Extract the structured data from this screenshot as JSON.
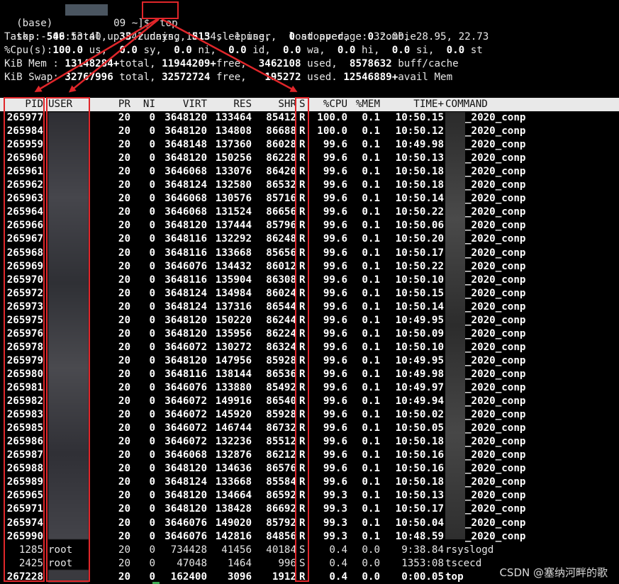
{
  "prompt": {
    "prefix": "(base) ",
    "host_suffix": "09 ~]$ ",
    "command": "top"
  },
  "summary": {
    "line1": "top - 09:53:40 up 542 days, 18:54,  1 user,  load average: 32.00, 28.95, 22.73",
    "tasks_label": "Tasks: ",
    "tasks_total": "546",
    "tasks_total_lbl": " total,  ",
    "tasks_running": "33",
    "tasks_running_lbl": " running, ",
    "tasks_sleeping": "513",
    "tasks_sleeping_lbl": " sleeping,   ",
    "tasks_stopped": "0",
    "tasks_stopped_lbl": " stopped,   ",
    "tasks_zombie": "0",
    "tasks_zombie_lbl": " zombie",
    "cpu_label": "%Cpu(s):",
    "cpu_us": "100.0",
    "cpu_us_lbl": " us,  ",
    "cpu_sy": "0.0",
    "cpu_sy_lbl": " sy,  ",
    "cpu_ni": "0.0",
    "cpu_ni_lbl": " ni,  ",
    "cpu_id": "0.0",
    "cpu_id_lbl": " id,  ",
    "cpu_wa": "0.0",
    "cpu_wa_lbl": " wa,  ",
    "cpu_hi": "0.0",
    "cpu_hi_lbl": " hi,  ",
    "cpu_si": "0.0",
    "cpu_si_lbl": " si,  ",
    "cpu_st": "0.0",
    "cpu_st_lbl": " st",
    "mem_label": "KiB Mem : ",
    "mem_total": "13148284+",
    "mem_total_lbl": "total, ",
    "mem_free": "11944209+",
    "mem_free_lbl": "free,  ",
    "mem_used": "3462108",
    "mem_used_lbl": " used,  ",
    "mem_cache": "8578632",
    "mem_cache_lbl": " buff/cache",
    "swap_label": "KiB Swap: ",
    "swap_total": "32767996",
    "swap_total_lbl": " total, ",
    "swap_free": "32572724",
    "swap_free_lbl": " free,   ",
    "swap_used": "195272",
    "swap_used_lbl": " used. ",
    "swap_avail": "12546889+",
    "swap_avail_lbl": "avail Mem"
  },
  "columns": {
    "pid": "PID",
    "user": "USER",
    "pr": "PR",
    "ni": "NI",
    "virt": "VIRT",
    "res": "RES",
    "shr": "SHR",
    "s": "S",
    "cpu": "%CPU",
    "mem": "%MEM",
    "time": "TIME+",
    "command": "COMMAND"
  },
  "processes": [
    {
      "pid": "265977",
      "user": "",
      "pr": "20",
      "ni": "0",
      "virt": "3648120",
      "res": "133464",
      "shr": "85412",
      "s": "R",
      "cpu": "100.0",
      "mem": "0.1",
      "time": "10:50.15",
      "command": "_2020_conp",
      "bold": true
    },
    {
      "pid": "265984",
      "user": "",
      "pr": "20",
      "ni": "0",
      "virt": "3648120",
      "res": "134808",
      "shr": "86688",
      "s": "R",
      "cpu": "100.0",
      "mem": "0.1",
      "time": "10:50.12",
      "command": "_2020_conp",
      "bold": true
    },
    {
      "pid": "265959",
      "user": "",
      "pr": "20",
      "ni": "0",
      "virt": "3648148",
      "res": "137360",
      "shr": "86028",
      "s": "R",
      "cpu": "99.6",
      "mem": "0.1",
      "time": "10:49.98",
      "command": "_2020_conp",
      "bold": true
    },
    {
      "pid": "265960",
      "user": "",
      "pr": "20",
      "ni": "0",
      "virt": "3648120",
      "res": "150256",
      "shr": "86228",
      "s": "R",
      "cpu": "99.6",
      "mem": "0.1",
      "time": "10:50.13",
      "command": "_2020_conp",
      "bold": true
    },
    {
      "pid": "265961",
      "user": "",
      "pr": "20",
      "ni": "0",
      "virt": "3646068",
      "res": "133076",
      "shr": "86420",
      "s": "R",
      "cpu": "99.6",
      "mem": "0.1",
      "time": "10:50.18",
      "command": "_2020_conp",
      "bold": true
    },
    {
      "pid": "265962",
      "user": "",
      "pr": "20",
      "ni": "0",
      "virt": "3648124",
      "res": "132580",
      "shr": "86532",
      "s": "R",
      "cpu": "99.6",
      "mem": "0.1",
      "time": "10:50.18",
      "command": "_2020_conp",
      "bold": true
    },
    {
      "pid": "265963",
      "user": "",
      "pr": "20",
      "ni": "0",
      "virt": "3646068",
      "res": "130576",
      "shr": "85716",
      "s": "R",
      "cpu": "99.6",
      "mem": "0.1",
      "time": "10:50.14",
      "command": "_2020_conp",
      "bold": true
    },
    {
      "pid": "265964",
      "user": "",
      "pr": "20",
      "ni": "0",
      "virt": "3646068",
      "res": "131524",
      "shr": "86656",
      "s": "R",
      "cpu": "99.6",
      "mem": "0.1",
      "time": "10:50.22",
      "command": "_2020_conp",
      "bold": true
    },
    {
      "pid": "265966",
      "user": "",
      "pr": "20",
      "ni": "0",
      "virt": "3648120",
      "res": "137444",
      "shr": "85796",
      "s": "R",
      "cpu": "99.6",
      "mem": "0.1",
      "time": "10:50.06",
      "command": "_2020_conp",
      "bold": true
    },
    {
      "pid": "265967",
      "user": "",
      "pr": "20",
      "ni": "0",
      "virt": "3648116",
      "res": "132292",
      "shr": "86248",
      "s": "R",
      "cpu": "99.6",
      "mem": "0.1",
      "time": "10:50.20",
      "command": "_2020_conp",
      "bold": true
    },
    {
      "pid": "265968",
      "user": "",
      "pr": "20",
      "ni": "0",
      "virt": "3648116",
      "res": "133668",
      "shr": "85656",
      "s": "R",
      "cpu": "99.6",
      "mem": "0.1",
      "time": "10:50.17",
      "command": "_2020_conp",
      "bold": true
    },
    {
      "pid": "265969",
      "user": "",
      "pr": "20",
      "ni": "0",
      "virt": "3646076",
      "res": "134432",
      "shr": "86012",
      "s": "R",
      "cpu": "99.6",
      "mem": "0.1",
      "time": "10:50.22",
      "command": "_2020_conp",
      "bold": true
    },
    {
      "pid": "265970",
      "user": "",
      "pr": "20",
      "ni": "0",
      "virt": "3648116",
      "res": "135904",
      "shr": "86308",
      "s": "R",
      "cpu": "99.6",
      "mem": "0.1",
      "time": "10:50.10",
      "command": "_2020_conp",
      "bold": true
    },
    {
      "pid": "265972",
      "user": "",
      "pr": "20",
      "ni": "0",
      "virt": "3648124",
      "res": "134984",
      "shr": "86024",
      "s": "R",
      "cpu": "99.6",
      "mem": "0.1",
      "time": "10:50.15",
      "command": "_2020_conp",
      "bold": true
    },
    {
      "pid": "265973",
      "user": "",
      "pr": "20",
      "ni": "0",
      "virt": "3648124",
      "res": "137316",
      "shr": "86544",
      "s": "R",
      "cpu": "99.6",
      "mem": "0.1",
      "time": "10:50.14",
      "command": "_2020_conp",
      "bold": true
    },
    {
      "pid": "265975",
      "user": "",
      "pr": "20",
      "ni": "0",
      "virt": "3648120",
      "res": "150220",
      "shr": "86244",
      "s": "R",
      "cpu": "99.6",
      "mem": "0.1",
      "time": "10:49.95",
      "command": "_2020_conp",
      "bold": true
    },
    {
      "pid": "265976",
      "user": "",
      "pr": "20",
      "ni": "0",
      "virt": "3648120",
      "res": "135956",
      "shr": "86224",
      "s": "R",
      "cpu": "99.6",
      "mem": "0.1",
      "time": "10:50.09",
      "command": "_2020_conp",
      "bold": true
    },
    {
      "pid": "265978",
      "user": "",
      "pr": "20",
      "ni": "0",
      "virt": "3646072",
      "res": "130272",
      "shr": "86324",
      "s": "R",
      "cpu": "99.6",
      "mem": "0.1",
      "time": "10:50.10",
      "command": "_2020_conp",
      "bold": true
    },
    {
      "pid": "265979",
      "user": "",
      "pr": "20",
      "ni": "0",
      "virt": "3648120",
      "res": "147956",
      "shr": "85928",
      "s": "R",
      "cpu": "99.6",
      "mem": "0.1",
      "time": "10:49.95",
      "command": "_2020_conp",
      "bold": true
    },
    {
      "pid": "265980",
      "user": "",
      "pr": "20",
      "ni": "0",
      "virt": "3648116",
      "res": "138144",
      "shr": "86536",
      "s": "R",
      "cpu": "99.6",
      "mem": "0.1",
      "time": "10:49.98",
      "command": "_2020_conp",
      "bold": true
    },
    {
      "pid": "265981",
      "user": "",
      "pr": "20",
      "ni": "0",
      "virt": "3646076",
      "res": "133880",
      "shr": "85492",
      "s": "R",
      "cpu": "99.6",
      "mem": "0.1",
      "time": "10:49.97",
      "command": "_2020_conp",
      "bold": true
    },
    {
      "pid": "265982",
      "user": "",
      "pr": "20",
      "ni": "0",
      "virt": "3646072",
      "res": "149916",
      "shr": "86540",
      "s": "R",
      "cpu": "99.6",
      "mem": "0.1",
      "time": "10:49.94",
      "command": "_2020_conp",
      "bold": true
    },
    {
      "pid": "265983",
      "user": "",
      "pr": "20",
      "ni": "0",
      "virt": "3646072",
      "res": "145920",
      "shr": "85928",
      "s": "R",
      "cpu": "99.6",
      "mem": "0.1",
      "time": "10:50.02",
      "command": "_2020_conp",
      "bold": true
    },
    {
      "pid": "265985",
      "user": "",
      "pr": "20",
      "ni": "0",
      "virt": "3646072",
      "res": "146744",
      "shr": "86732",
      "s": "R",
      "cpu": "99.6",
      "mem": "0.1",
      "time": "10:50.05",
      "command": "_2020_conp",
      "bold": true
    },
    {
      "pid": "265986",
      "user": "",
      "pr": "20",
      "ni": "0",
      "virt": "3646072",
      "res": "132236",
      "shr": "85512",
      "s": "R",
      "cpu": "99.6",
      "mem": "0.1",
      "time": "10:50.18",
      "command": "_2020_conp",
      "bold": true
    },
    {
      "pid": "265987",
      "user": "",
      "pr": "20",
      "ni": "0",
      "virt": "3646068",
      "res": "132876",
      "shr": "86212",
      "s": "R",
      "cpu": "99.6",
      "mem": "0.1",
      "time": "10:50.16",
      "command": "_2020_conp",
      "bold": true
    },
    {
      "pid": "265988",
      "user": "",
      "pr": "20",
      "ni": "0",
      "virt": "3648120",
      "res": "134636",
      "shr": "86576",
      "s": "R",
      "cpu": "99.6",
      "mem": "0.1",
      "time": "10:50.16",
      "command": "_2020_conp",
      "bold": true
    },
    {
      "pid": "265989",
      "user": "",
      "pr": "20",
      "ni": "0",
      "virt": "3648124",
      "res": "133668",
      "shr": "85584",
      "s": "R",
      "cpu": "99.6",
      "mem": "0.1",
      "time": "10:50.18",
      "command": "_2020_conp",
      "bold": true
    },
    {
      "pid": "265965",
      "user": "",
      "pr": "20",
      "ni": "0",
      "virt": "3648120",
      "res": "134664",
      "shr": "86592",
      "s": "R",
      "cpu": "99.3",
      "mem": "0.1",
      "time": "10:50.13",
      "command": "_2020_conp",
      "bold": true
    },
    {
      "pid": "265971",
      "user": "",
      "pr": "20",
      "ni": "0",
      "virt": "3648120",
      "res": "138428",
      "shr": "86692",
      "s": "R",
      "cpu": "99.3",
      "mem": "0.1",
      "time": "10:50.17",
      "command": "_2020_conp",
      "bold": true
    },
    {
      "pid": "265974",
      "user": "",
      "pr": "20",
      "ni": "0",
      "virt": "3646076",
      "res": "149020",
      "shr": "85792",
      "s": "R",
      "cpu": "99.3",
      "mem": "0.1",
      "time": "10:50.04",
      "command": "_2020_conp",
      "bold": true
    },
    {
      "pid": "265990",
      "user": "",
      "pr": "20",
      "ni": "0",
      "virt": "3646076",
      "res": "142816",
      "shr": "84856",
      "s": "R",
      "cpu": "99.3",
      "mem": "0.1",
      "time": "10:48.59",
      "command": "_2020_conp",
      "bold": true
    },
    {
      "pid": "1285",
      "user": "root",
      "pr": "20",
      "ni": "0",
      "virt": "734428",
      "res": "41456",
      "shr": "40184",
      "s": "S",
      "cpu": "0.4",
      "mem": "0.0",
      "time": "9:38.84",
      "command": "rsyslogd",
      "bold": false
    },
    {
      "pid": "2425",
      "user": "root",
      "pr": "20",
      "ni": "0",
      "virt": "47048",
      "res": "1464",
      "shr": "996",
      "s": "S",
      "cpu": "0.4",
      "mem": "0.0",
      "time": "1353:08",
      "command": "tscecd",
      "bold": false
    },
    {
      "pid": "267228",
      "user": "",
      "pr": "20",
      "ni": "0",
      "virt": "162400",
      "res": "3096",
      "shr": "1912",
      "s": "R",
      "cpu": "0.4",
      "mem": "0.0",
      "time": "0:00.05",
      "command": "top",
      "bold": true
    }
  ],
  "watermark": "CSDN @塞纳河畔的歌",
  "colors": {
    "annotation": "#e0262a",
    "header_bg": "#e9e9e9",
    "background": "#000000"
  }
}
